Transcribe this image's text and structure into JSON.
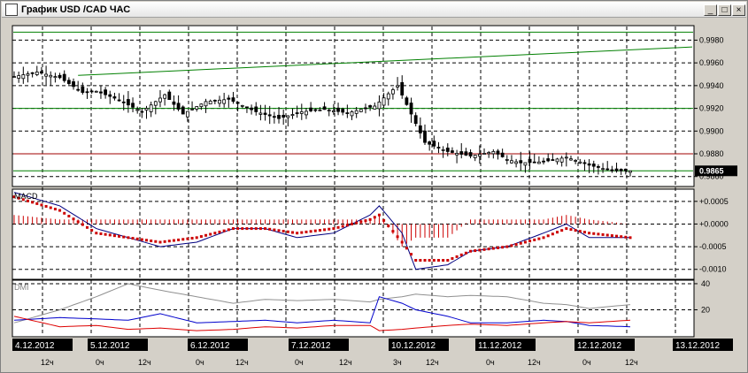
{
  "window": {
    "title": "График USD /CAD  ЧАС",
    "min_glyph": "_",
    "max_glyph": "□",
    "close_glyph": "×"
  },
  "colors": {
    "background": "#ffffff",
    "grid": "#000000",
    "trend_green": "#008000",
    "level_red": "#a00000",
    "macd_signal": "#cc0000",
    "macd_line": "#000080",
    "dmi_adx": "#909090",
    "dmi_plus": "#0000cc",
    "dmi_minus": "#dd0000",
    "price_box": "#000000"
  },
  "price_panel": {
    "y_min": 0.9852,
    "y_max": 0.9992,
    "tick_labels": [
      "0.9980",
      "0.9960",
      "0.9940",
      "0.9920",
      "0.9900",
      "0.9880",
      "0.9860"
    ],
    "tick_values": [
      0.998,
      0.996,
      0.994,
      0.992,
      0.99,
      0.988,
      0.986
    ],
    "current_price_label": "0.9865",
    "current_price_value": 0.9865
  },
  "macd_panel": {
    "title": "MACD",
    "y_min": -0.0012,
    "y_max": 0.00075,
    "tick_labels": [
      "+0.0005",
      "+0.0000",
      "-0.0005",
      "-0.0010"
    ],
    "tick_values": [
      0.0005,
      0.0,
      -0.0005,
      -0.001
    ]
  },
  "dmi_panel": {
    "title": "DMI",
    "y_min": 0,
    "y_max": 42,
    "tick_labels": [
      "40",
      "20"
    ],
    "tick_values": [
      40,
      20
    ]
  },
  "time_axis": {
    "dates": [
      "4.12.2012",
      "5.12.2012",
      "6.12.2012",
      "7.12.2012",
      "10.12.2012",
      "11.12.2012",
      "12.12.2012",
      "13.12.2012"
    ],
    "hours": [
      "12ч",
      "0ч",
      "12ч",
      "0ч",
      "12ч",
      "0ч",
      "12ч",
      "3ч",
      "12ч",
      "0ч",
      "12ч",
      "0ч",
      "12ч"
    ]
  },
  "chart_data": {
    "type": "line",
    "title": "График USD /CAD  ЧАС",
    "bar_index_range": [
      0,
      135
    ],
    "price_series": {
      "name": "USD/CAD",
      "x": [
        0,
        5,
        10,
        15,
        18,
        22,
        28,
        33,
        37,
        42,
        47,
        53,
        58,
        63,
        68,
        73,
        79,
        84,
        90,
        95,
        100,
        105,
        108,
        111,
        116,
        121,
        126,
        131,
        134
      ],
      "values": [
        0.9948,
        0.9952,
        0.9947,
        0.9934,
        0.9935,
        0.9929,
        0.9917,
        0.9932,
        0.9915,
        0.9926,
        0.9928,
        0.9917,
        0.9911,
        0.9917,
        0.9919,
        0.9916,
        0.9922,
        0.994,
        0.989,
        0.9882,
        0.9878,
        0.9882,
        0.9875,
        0.9872,
        0.9873,
        0.9877,
        0.987,
        0.9865,
        0.9865
      ]
    },
    "trend_lines": [
      {
        "from": [
          14,
          0.9949
        ],
        "to": [
          135,
          0.9974
        ]
      }
    ],
    "horizontal_levels": [
      {
        "value": 0.9987,
        "kind": "green"
      },
      {
        "value": 0.992,
        "kind": "green"
      },
      {
        "value": 0.988,
        "kind": "red"
      },
      {
        "value": 0.9865,
        "kind": "green"
      }
    ],
    "macd": {
      "x": [
        0,
        10,
        18,
        25,
        32,
        40,
        48,
        55,
        62,
        70,
        78,
        80,
        85,
        88,
        95,
        100,
        108,
        116,
        121,
        126,
        135
      ],
      "macd_line": [
        0.0007,
        0.0004,
        -0.0001,
        -0.0003,
        -0.0005,
        -0.0004,
        -0.0001,
        -0.0001,
        -0.0003,
        -0.0002,
        0.0002,
        0.0004,
        -0.0002,
        -0.001,
        -0.0009,
        -0.0006,
        -0.0005,
        -0.0002,
        0.0,
        -0.0003,
        -0.0003
      ],
      "signal_line": [
        0.0006,
        0.0003,
        -0.0002,
        -0.0003,
        -0.0004,
        -0.0003,
        -0.0001,
        -0.0001,
        -0.0002,
        -0.0001,
        0.0001,
        0.0002,
        -0.0004,
        -0.0008,
        -0.0008,
        -0.0006,
        -0.0005,
        -0.0003,
        -0.0001,
        -0.0002,
        -0.0003
      ],
      "histogram": [
        0.0002,
        0.0001,
        0.0001,
        0.0001,
        0.0001,
        0.0001,
        0.0001,
        0.0001,
        0.0001,
        0.0001,
        0.0001,
        0.0002,
        -0.0005,
        -0.0003,
        -0.0003,
        0.0001,
        0.0001,
        0.0001,
        0.0002,
        0.0001,
        0.0
      ]
    },
    "dmi": {
      "x": [
        0,
        10,
        18,
        25,
        32,
        40,
        48,
        55,
        62,
        70,
        78,
        80,
        85,
        88,
        95,
        100,
        108,
        116,
        121,
        126,
        135
      ],
      "adx": [
        10,
        20,
        30,
        40,
        35,
        30,
        25,
        28,
        27,
        28,
        26,
        28,
        30,
        32,
        30,
        31,
        30,
        25,
        24,
        21,
        24
      ],
      "plus_di": [
        12,
        14,
        13,
        12,
        17,
        10,
        11,
        12,
        10,
        12,
        10,
        30,
        25,
        20,
        15,
        10,
        10,
        12,
        11,
        8,
        7
      ],
      "minus_di": [
        15,
        7,
        8,
        5,
        6,
        4,
        5,
        7,
        6,
        8,
        8,
        4,
        5,
        6,
        8,
        9,
        8,
        10,
        11,
        10,
        12
      ]
    }
  }
}
